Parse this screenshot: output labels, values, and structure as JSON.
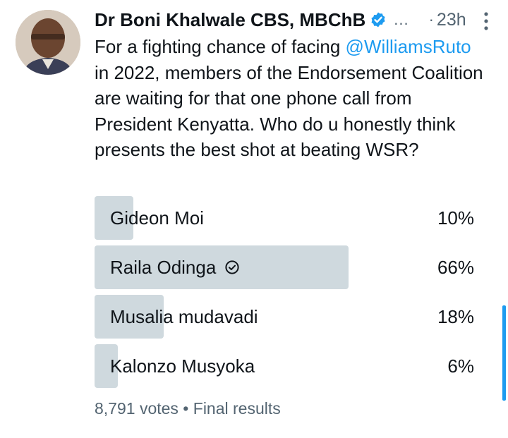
{
  "tweet": {
    "author_name": "Dr Boni Khalwale CBS, MBChB",
    "ellipsis": "...",
    "separator": "·",
    "time": "23h",
    "text_before": "For a fighting chance of  facing ",
    "mention": "@WilliamsRuto",
    "text_after": " in 2022, members of the Endorsement Coalition are waiting for that one phone call from President Kenyatta. Who do u honestly think presents the best shot at beating WSR?"
  },
  "poll": {
    "options": [
      {
        "label": "Gideon Moi",
        "percent": "10%",
        "value": 10,
        "winner": false
      },
      {
        "label": "Raila Odinga",
        "percent": "66%",
        "value": 66,
        "winner": true
      },
      {
        "label": "Musalia mudavadi",
        "percent": "18%",
        "value": 18,
        "winner": false
      },
      {
        "label": "Kalonzo Musyoka",
        "percent": "6%",
        "value": 6,
        "winner": false
      }
    ],
    "votes": "8,791 votes",
    "footer_separator": " • ",
    "status": "Final results"
  },
  "colors": {
    "accent": "#1d9bf0",
    "bar": "#cfd9de",
    "muted": "#536471"
  },
  "icons": {
    "verified": "verified-badge-icon",
    "more": "more-vertical-icon",
    "winner": "check-circle-icon"
  }
}
